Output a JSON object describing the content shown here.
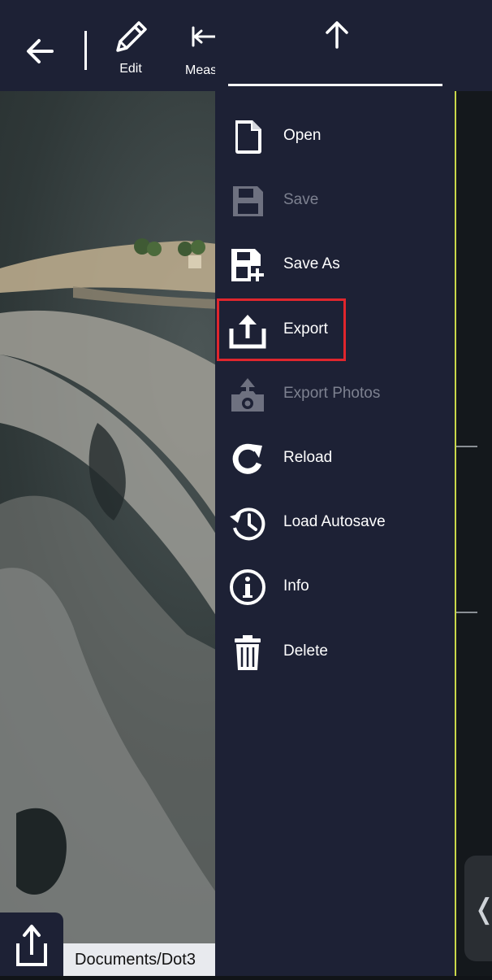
{
  "toolbar": {
    "back_icon": "arrow-left-icon",
    "edit_label": "Edit",
    "measure_label": "Meas"
  },
  "drawer": {
    "up_icon": "arrow-up-icon",
    "items": [
      {
        "label": "Open",
        "icon": "file-icon",
        "enabled": true
      },
      {
        "label": "Save",
        "icon": "save-icon",
        "enabled": false
      },
      {
        "label": "Save As",
        "icon": "save-as-icon",
        "enabled": true
      },
      {
        "label": "Export",
        "icon": "export-icon",
        "enabled": true,
        "highlighted": true
      },
      {
        "label": "Export Photos",
        "icon": "export-photos-icon",
        "enabled": false
      },
      {
        "label": "Reload",
        "icon": "reload-icon",
        "enabled": true
      },
      {
        "label": "Load Autosave",
        "icon": "history-icon",
        "enabled": true
      },
      {
        "label": "Info",
        "icon": "info-icon",
        "enabled": true
      },
      {
        "label": "Delete",
        "icon": "trash-icon",
        "enabled": true
      }
    ]
  },
  "bottom": {
    "path": "Documents/Dot3",
    "share_icon": "share-icon"
  },
  "side_handle": {
    "icon": "chevron-left-icon"
  },
  "colors": {
    "panel": "#1d2135",
    "highlight": "#e0262d",
    "accent_line": "#c9d84a",
    "disabled_text": "#7d8190"
  }
}
